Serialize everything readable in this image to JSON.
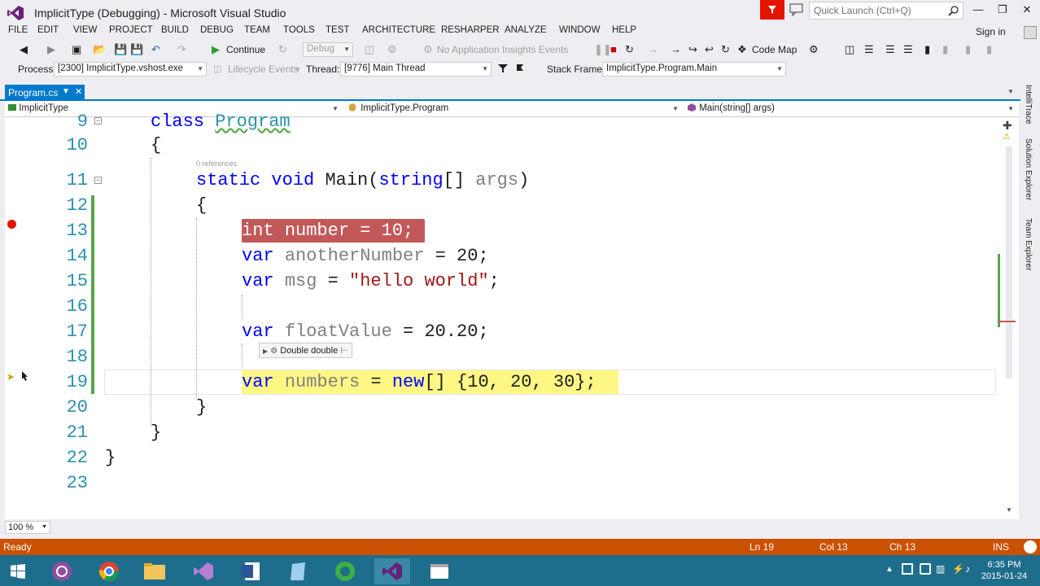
{
  "window": {
    "title": "ImplicitType (Debugging) - Microsoft Visual Studio",
    "quick_launch_placeholder": "Quick Launch (Ctrl+Q)"
  },
  "menu": [
    "FILE",
    "EDIT",
    "VIEW",
    "PROJECT",
    "BUILD",
    "DEBUG",
    "TEAM",
    "TOOLS",
    "TEST",
    "ARCHITECTURE",
    "RESHARPER",
    "ANALYZE",
    "WINDOW",
    "HELP"
  ],
  "signin": "Sign in",
  "toolbar": {
    "continue_label": "Continue",
    "config_value": "Debug",
    "insights_label": "No Application Insights Events",
    "codemap_label": "Code Map"
  },
  "debug_location": {
    "process_label": "Process:",
    "process_value": "[2300] ImplicitType.vshost.exe",
    "lifecycle_label": "Lifecycle Events",
    "thread_label": "Thread:",
    "thread_value": "[9776] Main Thread",
    "stackframe_label": "Stack Frame:",
    "stackframe_value": "ImplicitType.Program.Main"
  },
  "tab": {
    "label": "Program.cs"
  },
  "nav": {
    "project": "ImplicitType",
    "type": "ImplicitType.Program",
    "member": "Main(string[] args)"
  },
  "editor": {
    "references_hint": "0 references",
    "line_numbers": [
      "9",
      "10",
      "11",
      "12",
      "13",
      "14",
      "15",
      "16",
      "17",
      "18",
      "19",
      "20",
      "21",
      "22",
      "23"
    ],
    "lines": {
      "l9_kw": "class",
      "l9_ty": "Program",
      "l10": "{",
      "l11_kw1": "static",
      "l11_kw2": "void",
      "l11_name": "Main(",
      "l11_kw3": "string",
      "l11_rest": "[] ",
      "l11_param": "args",
      "l11_close": ")",
      "l12": "{",
      "l13_kw": "int",
      "l13_name": "number",
      "l13_rest": " = 10;",
      "l14_kw": "var",
      "l14_name": "anotherNumber",
      "l14_rest": " = 20;",
      "l15_kw": "var",
      "l15_name": "msg",
      "l15_eq": " = ",
      "l15_str": "\"hello world\"",
      "l15_semi": ";",
      "l17_kw": "var",
      "l17_name": "floatValue",
      "l17_rest": " = 20.20;",
      "l19_kw": "var",
      "l19_name": "numbers",
      "l19_eq": " = ",
      "l19_kw2": "new",
      "l19_rest": "[] {10, 20, 30};",
      "l20": "}",
      "l21": "}",
      "l22": "}"
    },
    "datatip": "Double  double"
  },
  "zoom": "100 %",
  "status": {
    "ready": "Ready",
    "ln": "Ln 19",
    "col": "Col 13",
    "ch": "Ch 13",
    "ins": "INS"
  },
  "sidebar_tabs": [
    "IntelliTrace",
    "Solution Explorer",
    "Team Explorer"
  ],
  "clock": {
    "time": "6:35 PM",
    "date": "2015-01-24"
  },
  "colors": {
    "accent": "#007acc",
    "status_bar": "#ca5100",
    "breakpoint": "#c35858",
    "current_line": "#fef784",
    "keyword": "#0000ff",
    "type": "#2b91af",
    "string": "#a31515"
  }
}
